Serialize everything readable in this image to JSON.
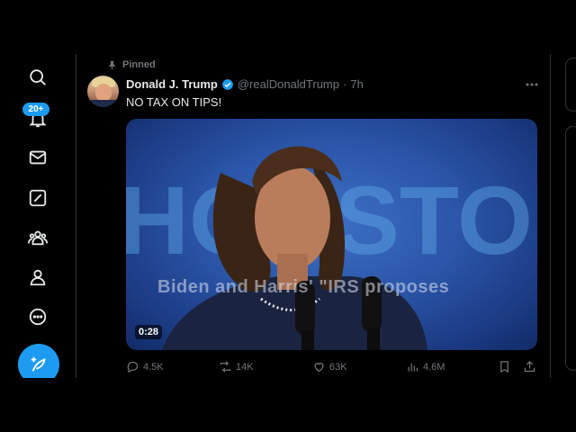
{
  "sidebar": {
    "notifications_badge": "20+",
    "nav": [
      {
        "name": "search"
      },
      {
        "name": "notifications"
      },
      {
        "name": "messages"
      },
      {
        "name": "grok"
      },
      {
        "name": "communities"
      },
      {
        "name": "profile"
      },
      {
        "name": "more"
      }
    ]
  },
  "tweet": {
    "pinned_label": "Pinned",
    "author_name": "Donald J. Trump",
    "handle": "@realDonaldTrump",
    "separator": "·",
    "time": "7h",
    "text": "NO TAX ON TIPS!",
    "media": {
      "duration": "0:28",
      "overlay_text": "Biden and Harris' \"IRS proposes",
      "background_text": "HOUSTON"
    },
    "stats": {
      "replies": "4.5K",
      "reposts": "14K",
      "likes": "63K",
      "views": "4.6M"
    }
  },
  "colors": {
    "background": "#000000",
    "accent": "#1d9bf0",
    "text_primary": "#e7e9ea",
    "text_secondary": "#71767b",
    "border": "#2f3336"
  }
}
